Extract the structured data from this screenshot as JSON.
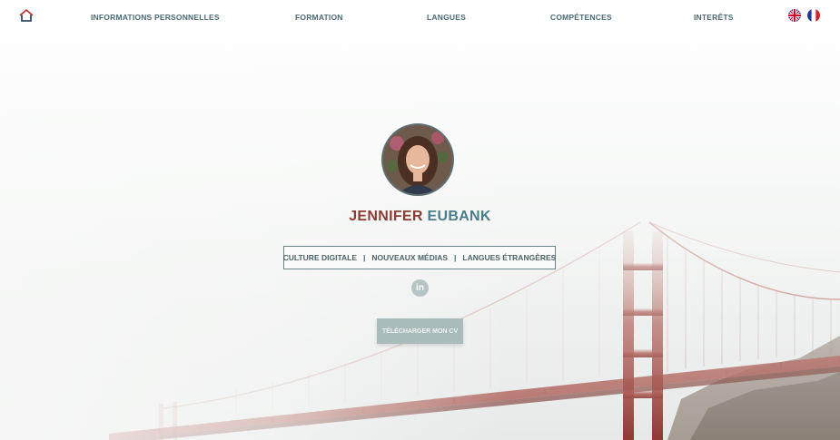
{
  "nav": {
    "home_icon": "home-icon",
    "links": [
      "INFORMATIONS PERSONNELLES",
      "FORMATION",
      "LANGUES",
      "COMPÉTENCES",
      "INTERÊTS"
    ],
    "languages": [
      "uk-flag-icon",
      "france-flag-icon"
    ]
  },
  "profile": {
    "first_name": "JENNIFER",
    "last_name": "EUBANK",
    "tags": [
      "CULTURE DIGITALE",
      "NOUVEAUX MÉDIAS",
      "LANGUES ÉTRANGÈRES"
    ],
    "separator": "|",
    "linkedin_label": "in",
    "download_label": "TÉLÉCHARGER MON CV"
  },
  "colors": {
    "nav_text": "#4c6a73",
    "first_name": "#8b3b32",
    "last_name": "#4a7d8b",
    "bridge": "#a5524a",
    "button": "#a9bcbb"
  }
}
